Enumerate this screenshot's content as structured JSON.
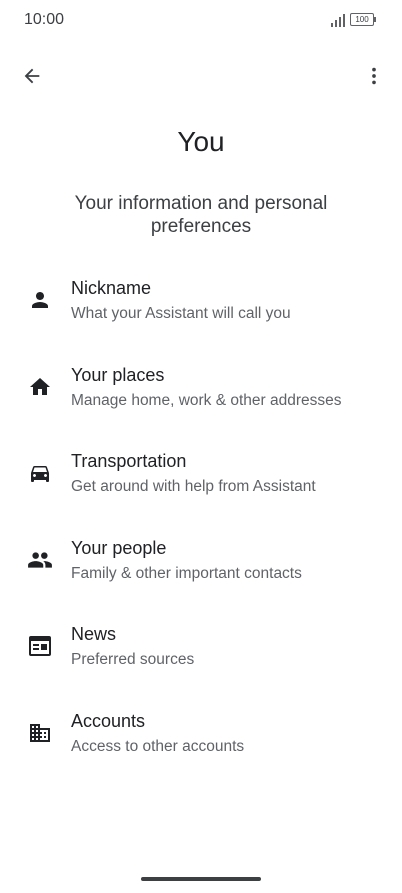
{
  "status_bar": {
    "time": "10:00",
    "battery_level": "100"
  },
  "top_bar": {
    "back_icon": "arrow-back-icon",
    "more_icon": "more-vert-icon"
  },
  "page": {
    "title": "You",
    "subtitle": "Your information and personal preferences"
  },
  "items": [
    {
      "icon": "person-icon",
      "title": "Nickname",
      "subtitle": "What your Assistant will call you"
    },
    {
      "icon": "home-icon",
      "title": "Your places",
      "subtitle": "Manage home, work & other addresses"
    },
    {
      "icon": "car-icon",
      "title": "Transportation",
      "subtitle": "Get around with help from Assistant"
    },
    {
      "icon": "people-icon",
      "title": "Your people",
      "subtitle": "Family & other important contacts"
    },
    {
      "icon": "news-icon",
      "title": "News",
      "subtitle": "Preferred sources"
    },
    {
      "icon": "building-icon",
      "title": "Accounts",
      "subtitle": "Access to other accounts"
    }
  ],
  "colors": {
    "text_primary": "#202124",
    "text_secondary": "#5f6368",
    "background": "#ffffff"
  }
}
